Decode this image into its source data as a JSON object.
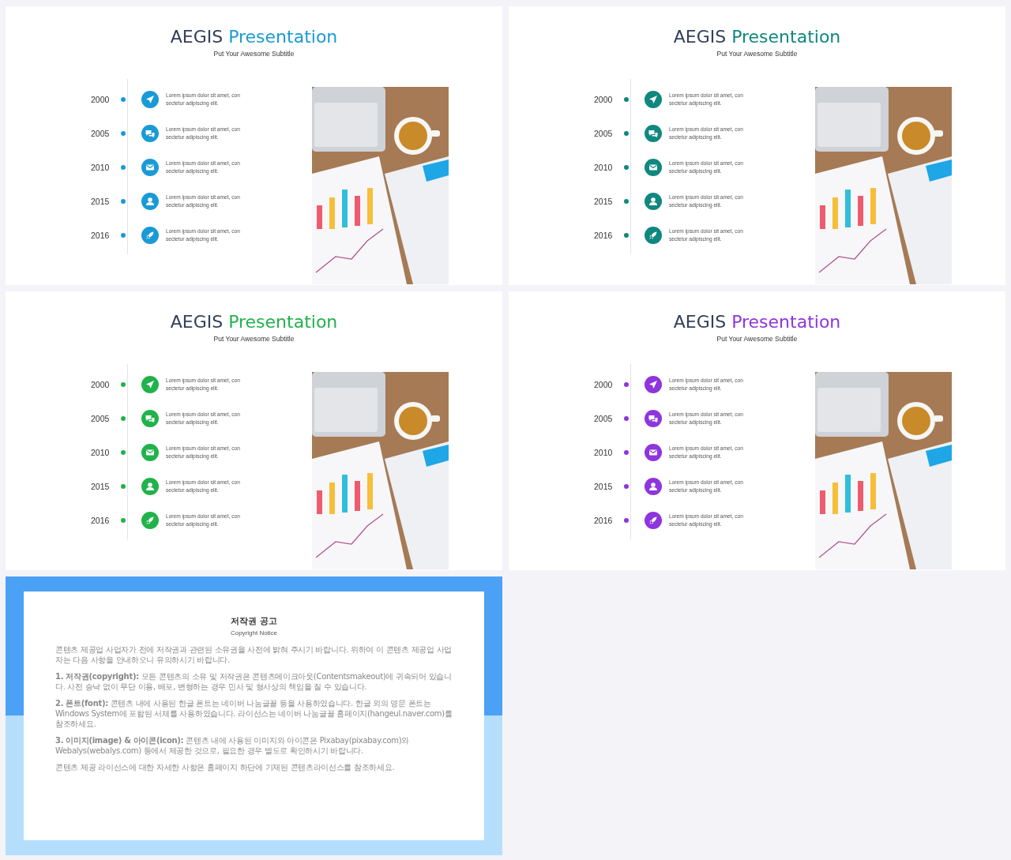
{
  "slides": [
    {
      "kind": "timeline",
      "title": "AEGIS",
      "title_accent": "Presentation",
      "color": "#1a9ad6",
      "subtitle": "Put Your Awesome Subtitle",
      "entries": [
        {
          "year": "2000",
          "text": "Lorem ipsum dolor sit amet, con\nsectetur adipiscing elit."
        },
        {
          "year": "2005",
          "text": "Lorem ipsum dolor sit amet, con\nsectetur adipiscing elit."
        },
        {
          "year": "2010",
          "text": "Lorem ipsum dolor sit amet, con\nsectetur adipiscing elit."
        },
        {
          "year": "2015",
          "text": "Lorem ipsum dolor sit amet, con\nsectetur adipiscing elit."
        },
        {
          "year": "2016",
          "text": "Lorem ipsum dolor sit amet, con\nsectetur adipiscing elit."
        }
      ]
    },
    {
      "kind": "timeline",
      "title": "AEGIS",
      "title_accent": "Presentation",
      "color": "#10877f",
      "subtitle": "Put Your Awesome Subtitle",
      "entries": [
        {
          "year": "2000",
          "text": "Lorem ipsum dolor sit amet, con\nsectetur adipiscing elit."
        },
        {
          "year": "2005",
          "text": "Lorem ipsum dolor sit amet, con\nsectetur adipiscing elit."
        },
        {
          "year": "2010",
          "text": "Lorem ipsum dolor sit amet, con\nsectetur adipiscing elit."
        },
        {
          "year": "2015",
          "text": "Lorem ipsum dolor sit amet, con\nsectetur adipiscing elit."
        },
        {
          "year": "2016",
          "text": "Lorem ipsum dolor sit amet, con\nsectetur adipiscing elit."
        }
      ]
    },
    {
      "kind": "timeline",
      "title": "AEGIS",
      "title_accent": "Presentation",
      "color": "#21b24b",
      "subtitle": "Put Your Awesome Subtitle",
      "entries": [
        {
          "year": "2000",
          "text": "Lorem ipsum dolor sit amet, con\nsectetur adipiscing elit."
        },
        {
          "year": "2005",
          "text": "Lorem ipsum dolor sit amet, con\nsectetur adipiscing elit."
        },
        {
          "year": "2010",
          "text": "Lorem ipsum dolor sit amet, con\nsectetur adipiscing elit."
        },
        {
          "year": "2015",
          "text": "Lorem ipsum dolor sit amet, con\nsectetur adipiscing elit."
        },
        {
          "year": "2016",
          "text": "Lorem ipsum dolor sit amet, con\nsectetur adipiscing elit."
        }
      ]
    },
    {
      "kind": "timeline",
      "title": "AEGIS",
      "title_accent": "Presentation",
      "color": "#8e35dd",
      "subtitle": "Put Your Awesome Subtitle",
      "entries": [
        {
          "year": "2000",
          "text": "Lorem ipsum dolor sit amet, con\nsectetur adipiscing elit."
        },
        {
          "year": "2005",
          "text": "Lorem ipsum dolor sit amet, con\nsectetur adipiscing elit."
        },
        {
          "year": "2010",
          "text": "Lorem ipsum dolor sit amet, con\nsectetur adipiscing elit."
        },
        {
          "year": "2015",
          "text": "Lorem ipsum dolor sit amet, con\nsectetur adipiscing elit."
        },
        {
          "year": "2016",
          "text": "Lorem ipsum dolor sit amet, con\nsectetur adipiscing elit."
        }
      ]
    },
    {
      "kind": "notice",
      "title": "저작권 공고",
      "subtitle": "Copyright Notice",
      "paragraphs": [
        "콘텐츠 제공업 사업자가 전에 저작권과 관련된 소유권을 사전에 밝혀 주시기 바랍니다. 위하여 이 콘텐츠 제공업 사업자는 다음 사항을 안내하오니 유의하시기 바랍니다.",
        "**1. 저작권(copyright):** 모든 콘텐츠의 소유 및 저작권은 콘텐츠메이크아웃(Contentsmakeout)에 귀속되어 있습니다. 사전 승낙 없이 무단 이용, 배포, 변형하는 경우 민사 및 형사상의 책임을 질 수 있습니다.",
        "**2. 폰트(font):** 콘텐츠 내에 사용된 한글 폰트는 네이버 나눔글꼴 등을 사용하였습니다. 한글 외의 영문 폰트는 Windows System에 포함된 서체를 사용하였습니다. 라이선스는 네이버 나눔글꼴 홈페이지(hangeul.naver.com)를 참조하세요.",
        "**3. 이미지(image) & 아이콘(icon):** 콘텐츠 내에 사용된 이미지와 아이콘은 Pixabay(pixabay.com)와 Webalys(webalys.com) 등에서 제공한 것으로, 필요한 경우 별도로 확인하시기 바랍니다.",
        "콘텐츠 제공 라이선스에 대한 자세한 사항은 홈페이지 하단에 기재된 콘텐츠라이선스를 참조하세요."
      ]
    }
  ]
}
